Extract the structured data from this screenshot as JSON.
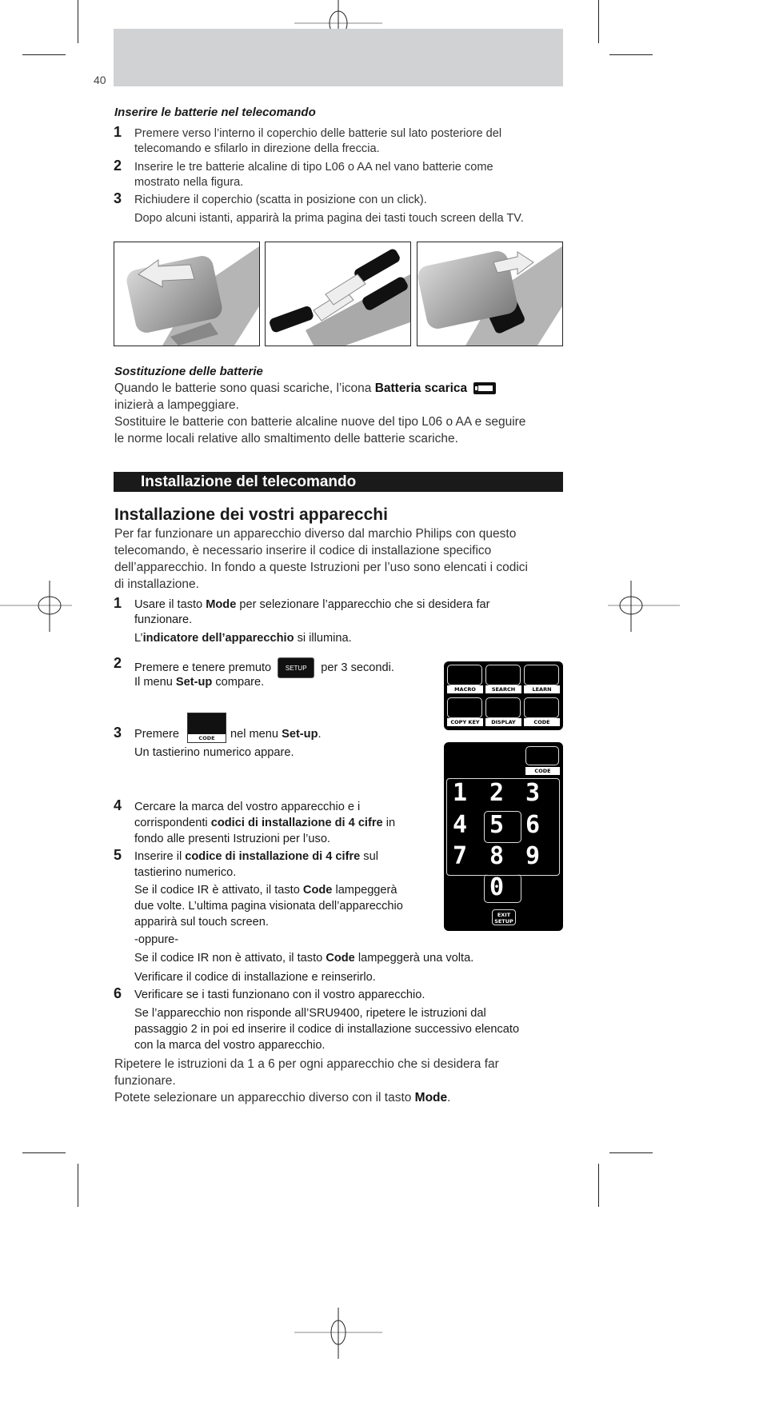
{
  "page": {
    "number": "40"
  },
  "battery_insert": {
    "heading": "Inserire le batterie nel telecomando",
    "steps": [
      {
        "num": "1",
        "lines": [
          "Premere verso l’interno il coperchio delle batterie sul lato posteriore del",
          "telecomando e sfilarlo in direzione della freccia."
        ]
      },
      {
        "num": "2",
        "lines": [
          "Inserire le tre batterie alcaline di tipo L06 o AA nel vano batterie come",
          "mostrato nella figura."
        ]
      },
      {
        "num": "3",
        "lines": [
          "Richiudere il coperchio (scatta in posizione con un click).",
          "Dopo alcuni istanti, apparirà la prima pagina dei tasti touch screen della TV."
        ]
      }
    ],
    "figures": [
      "remove-cover-illustration",
      "insert-batteries-illustration",
      "close-cover-illustration"
    ]
  },
  "battery_replace": {
    "heading": "Sostituzione delle batterie",
    "line1_pre": "Quando le batterie sono quasi scariche, l’icona ",
    "line1_bold": "Batteria scarica",
    "line2": "inizierà a lampeggiare.",
    "line3": "Sostituire le batterie con batterie alcaline nuove del tipo L06 o AA e seguire",
    "line4": "le norme locali relative allo smaltimento delle batterie scariche."
  },
  "section": {
    "title": "Installazione del telecomando"
  },
  "install": {
    "heading": "Installazione dei vostri apparecchi",
    "intro": [
      "Per far funzionare un apparecchio diverso dal marchio Philips con questo",
      "telecomando, è necessario inserire il codice di installazione specifico",
      "dell’apparecchio. In fondo a queste Istruzioni per l’uso sono elencati i codici",
      "di installazione."
    ],
    "step1": {
      "num": "1",
      "a": "Usare il tasto ",
      "a_b": "Mode",
      "a2": " per selezionare l’apparecchio che si desidera far",
      "b": "funzionare.",
      "c_pre": "L’",
      "c_b": "indicatore dell’apparecchio",
      "c_post": " si illumina."
    },
    "step2": {
      "num": "2",
      "a": "Premere e tenere premuto",
      "key": "SETUP",
      "a2": "per 3 secondi.",
      "b_pre": "Il menu ",
      "b_b": "Set-up",
      "b_post": " compare."
    },
    "step3": {
      "num": "3",
      "a": "Premere",
      "key": "CODE",
      "a2_pre": "nel menu ",
      "a2_b": "Set-up",
      "a2_post": ".",
      "b": "Un tastierino numerico appare."
    },
    "step4": {
      "num": "4",
      "a": "Cercare la marca del vostro apparecchio e i",
      "b_pre": "corrispondenti ",
      "b_b": "codici di installazione di 4 cifre",
      "b_post": " in",
      "c": "fondo alle presenti Istruzioni per l’uso."
    },
    "step5": {
      "num": "5",
      "a_pre": "Inserire il ",
      "a_b": "codice di installazione di 4 cifre",
      "a_post": " sul",
      "b": "tastierino numerico.",
      "c_pre": "Se il codice IR è attivato, il tasto ",
      "c_b": "Code",
      "c_post": " lampeggerà",
      "d": "due volte. L’ultima pagina visionata dell’apparecchio",
      "e": "apparirà sul touch screen.",
      "f": "-oppure-",
      "g_pre": "Se il codice IR non è attivato, il tasto ",
      "g_b": "Code",
      "g_post": " lampeggerà una volta.",
      "h": "Verificare il codice di installazione e reinserirlo."
    },
    "step6": {
      "num": "6",
      "a": "Verificare se i tasti funzionano con il vostro apparecchio.",
      "b": "Se l’apparecchio non risponde all’SRU9400, ripetere le istruzioni dal",
      "c": "passaggio 2 in poi ed inserire il codice di installazione successivo elencato",
      "d": "con la marca del vostro apparecchio."
    },
    "outro1": "Ripetere le istruzioni da 1 a 6 per ogni apparecchio che si desidera far",
    "outro2": "funzionare.",
    "outro3_pre": "Potete selezionare un apparecchio diverso con il tasto ",
    "outro3_b": "Mode",
    "outro3_post": "."
  },
  "setup_menu": {
    "keys": [
      "MACRO",
      "SEARCH",
      "LEARN",
      "COPY KEY",
      "DISPLAY",
      "CODE"
    ]
  },
  "keypad": {
    "code_label": "CODE",
    "digits": [
      "1",
      "2",
      "3",
      "4",
      "5",
      "6",
      "7",
      "8",
      "9",
      "0"
    ],
    "exit_label_1": "EXIT",
    "exit_label_2": "SETUP"
  }
}
